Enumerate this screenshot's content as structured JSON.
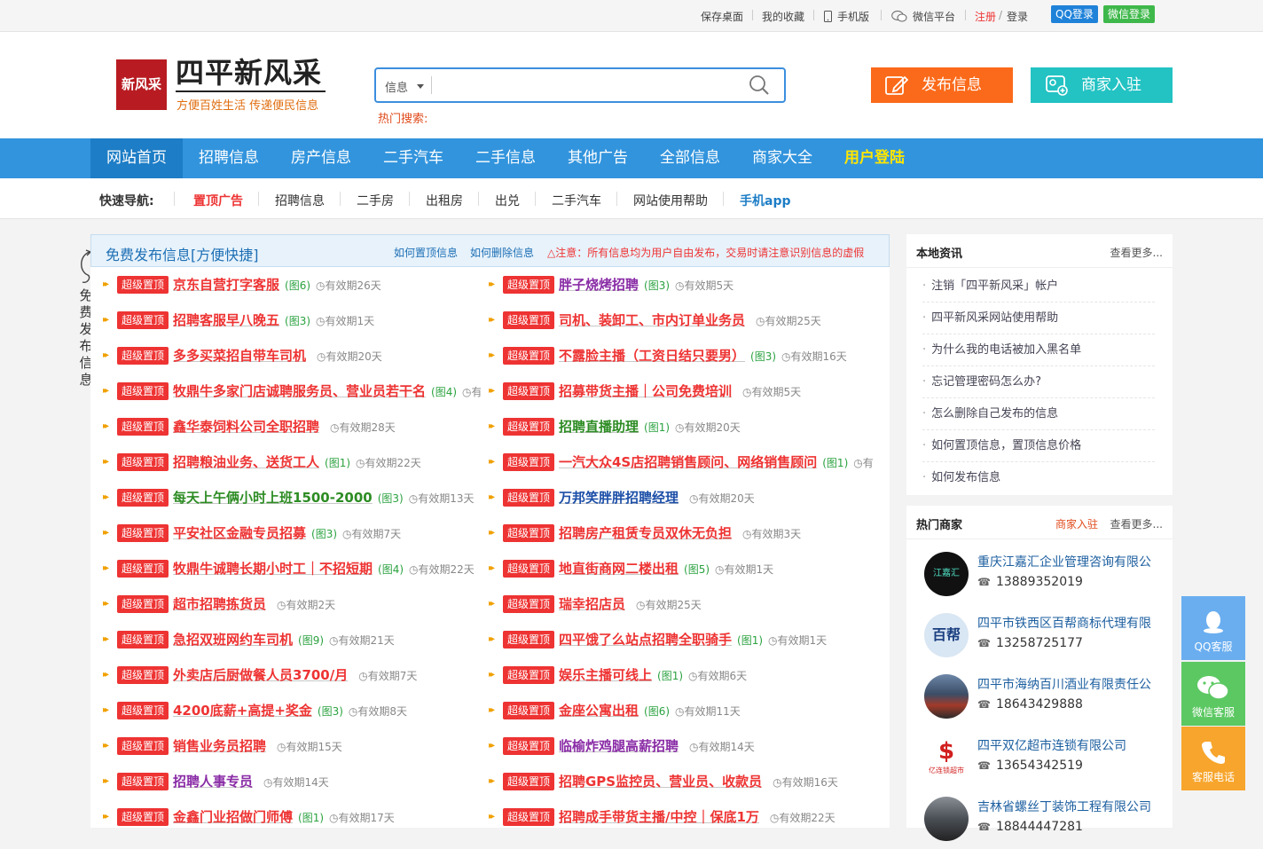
{
  "topbar": {
    "save_desktop": "保存桌面",
    "favorites": "我的收藏",
    "mobile": "手机版",
    "wechat": "微信平台",
    "register": "注册",
    "slash": "/",
    "login": "登录",
    "qq_login": "QQ登录",
    "wechat_login": "微信登录"
  },
  "header": {
    "logo_badge": "新风采",
    "logo_title": "四平新风采",
    "logo_slogan": "方便百姓生活 传递便民信息",
    "search_category": "信息",
    "search_placeholder": "",
    "hot_search": "热门搜索:",
    "publish_button": "发布信息",
    "merchant_button": "商家入驻"
  },
  "nav": [
    "网站首页",
    "招聘信息",
    "房产信息",
    "二手汽车",
    "二手信息",
    "其他广告",
    "全部信息",
    "商家大全",
    "用户登陆"
  ],
  "quick": {
    "label": "快速导航:",
    "items": [
      "置顶广告",
      "招聘信息",
      "二手房",
      "出租房",
      "出兑",
      "二手汽车",
      "网站使用帮助",
      "手机app"
    ]
  },
  "main": {
    "title": "免费发布信息[方便快捷]",
    "link1": "如何置顶信息",
    "link2": "如何删除信息",
    "warning": "△注意：所有信息均为用户自由发布，交易时请注意识别信息的虚假",
    "side_note": "免费发布信息",
    "tag": "超级置顶",
    "left": [
      {
        "title": "京东自营打字客服",
        "pics": "(图6)",
        "dur": "有效期26天",
        "color": "c-red"
      },
      {
        "title": "招聘客服早八晚五",
        "pics": "(图3)",
        "dur": "有效期1天",
        "color": "c-red"
      },
      {
        "title": "多多买菜招自带车司机",
        "pics": "",
        "dur": "有效期20天",
        "color": "c-red"
      },
      {
        "title": "牧鼎牛多家门店诚聘服务员、营业员若干名",
        "pics": "(图4)",
        "dur": "有",
        "color": "c-red"
      },
      {
        "title": "鑫华泰饲料公司全职招聘",
        "pics": "",
        "dur": "有效期28天",
        "color": "c-red"
      },
      {
        "title": "招聘粮油业务、送货工人",
        "pics": "(图1)",
        "dur": "有效期22天",
        "color": "c-red"
      },
      {
        "title": "每天上午俩小时上班1500-2000",
        "pics": "(图3)",
        "dur": "有效期13天",
        "color": "c-green"
      },
      {
        "title": "平安社区金融专员招募",
        "pics": "(图3)",
        "dur": "有效期7天",
        "color": "c-red"
      },
      {
        "title": "牧鼎牛诚聘长期小时工｜不招短期",
        "pics": "(图4)",
        "dur": "有效期22天",
        "color": "c-red"
      },
      {
        "title": "超市招聘拣货员",
        "pics": "",
        "dur": "有效期2天",
        "color": "c-red"
      },
      {
        "title": "急招双班网约车司机",
        "pics": "(图9)",
        "dur": "有效期21天",
        "color": "c-red"
      },
      {
        "title": "外卖店后厨做餐人员3700/月",
        "pics": "",
        "dur": "有效期7天",
        "color": "c-red"
      },
      {
        "title": "4200底薪+高提+奖金",
        "pics": "(图3)",
        "dur": "有效期8天",
        "color": "c-red"
      },
      {
        "title": "销售业务员招聘",
        "pics": "",
        "dur": "有效期15天",
        "color": "c-red"
      },
      {
        "title": "招聘人事专员",
        "pics": "",
        "dur": "有效期14天",
        "color": "c-purple"
      },
      {
        "title": "金鑫门业招做门师傅",
        "pics": "(图1)",
        "dur": "有效期17天",
        "color": "c-red"
      }
    ],
    "right": [
      {
        "title": "胖子烧烤招聘",
        "pics": "(图3)",
        "dur": "有效期5天",
        "color": "c-purple"
      },
      {
        "title": "司机、装卸工、市内订单业务员",
        "pics": "",
        "dur": "有效期25天",
        "color": "c-red"
      },
      {
        "title": "不露脸主播（工资日结只要男）",
        "pics": "(图3)",
        "dur": "有效期16天",
        "color": "c-red"
      },
      {
        "title": "招募带货主播｜公司免费培训",
        "pics": "",
        "dur": "有效期5天",
        "color": "c-red"
      },
      {
        "title": "招聘直播助理",
        "pics": "(图1)",
        "dur": "有效期20天",
        "color": "c-green"
      },
      {
        "title": "一汽大众4S店招聘销售顾问、网络销售顾问",
        "pics": "(图1)",
        "dur": "有",
        "color": "c-red"
      },
      {
        "title": "万邦笑胖胖招聘经理",
        "pics": "",
        "dur": "有效期20天",
        "color": "c-blue"
      },
      {
        "title": "招聘房产租赁专员双休无负担",
        "pics": "",
        "dur": "有效期3天",
        "color": "c-red"
      },
      {
        "title": "地直街商网二楼出租",
        "pics": "(图5)",
        "dur": "有效期1天",
        "color": "c-red"
      },
      {
        "title": "瑞幸招店员",
        "pics": "",
        "dur": "有效期25天",
        "color": "c-red"
      },
      {
        "title": "四平饿了么站点招聘全职骑手",
        "pics": "(图1)",
        "dur": "有效期1天",
        "color": "c-red"
      },
      {
        "title": "娱乐主播可线上",
        "pics": "(图1)",
        "dur": "有效期6天",
        "color": "c-red"
      },
      {
        "title": "金座公寓出租",
        "pics": "(图6)",
        "dur": "有效期11天",
        "color": "c-red"
      },
      {
        "title": "临榆炸鸡腿高薪招聘",
        "pics": "",
        "dur": "有效期14天",
        "color": "c-purple"
      },
      {
        "title": "招聘GPS监控员、营业员、收款员",
        "pics": "",
        "dur": "有效期16天",
        "color": "c-red"
      },
      {
        "title": "招聘成手带货主播/中控｜保底1万",
        "pics": "",
        "dur": "有效期22天",
        "color": "c-red"
      }
    ]
  },
  "news": {
    "title": "本地资讯",
    "more": "查看更多...",
    "items": [
      "注销「四平新风采」帐户",
      "四平新风采网站使用帮助",
      "为什么我的电话被加入黑名单",
      "忘记管理密码怎么办?",
      "怎么删除自己发布的信息",
      "如何置顶信息，置顶信息价格",
      "如何发布信息"
    ]
  },
  "merchants": {
    "title": "热门商家",
    "join": "商家入驻",
    "more": "查看更多...",
    "items": [
      {
        "name": "重庆江嘉汇企业管理咨询有限公",
        "phone": "13889352019",
        "avatar_text": "江嘉汇"
      },
      {
        "name": "四平市铁西区百帮商标代理有限",
        "phone": "13258725177",
        "avatar_text": "百帮"
      },
      {
        "name": "四平市海纳百川酒业有限责任公",
        "phone": "18643429888",
        "avatar_text": ""
      },
      {
        "name": "四平双亿超市连锁有限公司",
        "phone": "13654342519",
        "avatar_text": "亿连锁超市"
      },
      {
        "name": "吉林省螺丝丁装饰工程有限公司",
        "phone": "18844447281",
        "avatar_text": ""
      }
    ]
  },
  "float": {
    "qq": "QQ客服",
    "wechat": "微信客服",
    "phone": "客服电话"
  },
  "colors": {
    "nav": "#3294dd",
    "publish": "#fb6a1a",
    "merchant": "#23c2c3",
    "tag": "#ee3333",
    "float_blue": "#6aaef0",
    "float_green": "#5cc862",
    "float_orange": "#f7a52c"
  }
}
